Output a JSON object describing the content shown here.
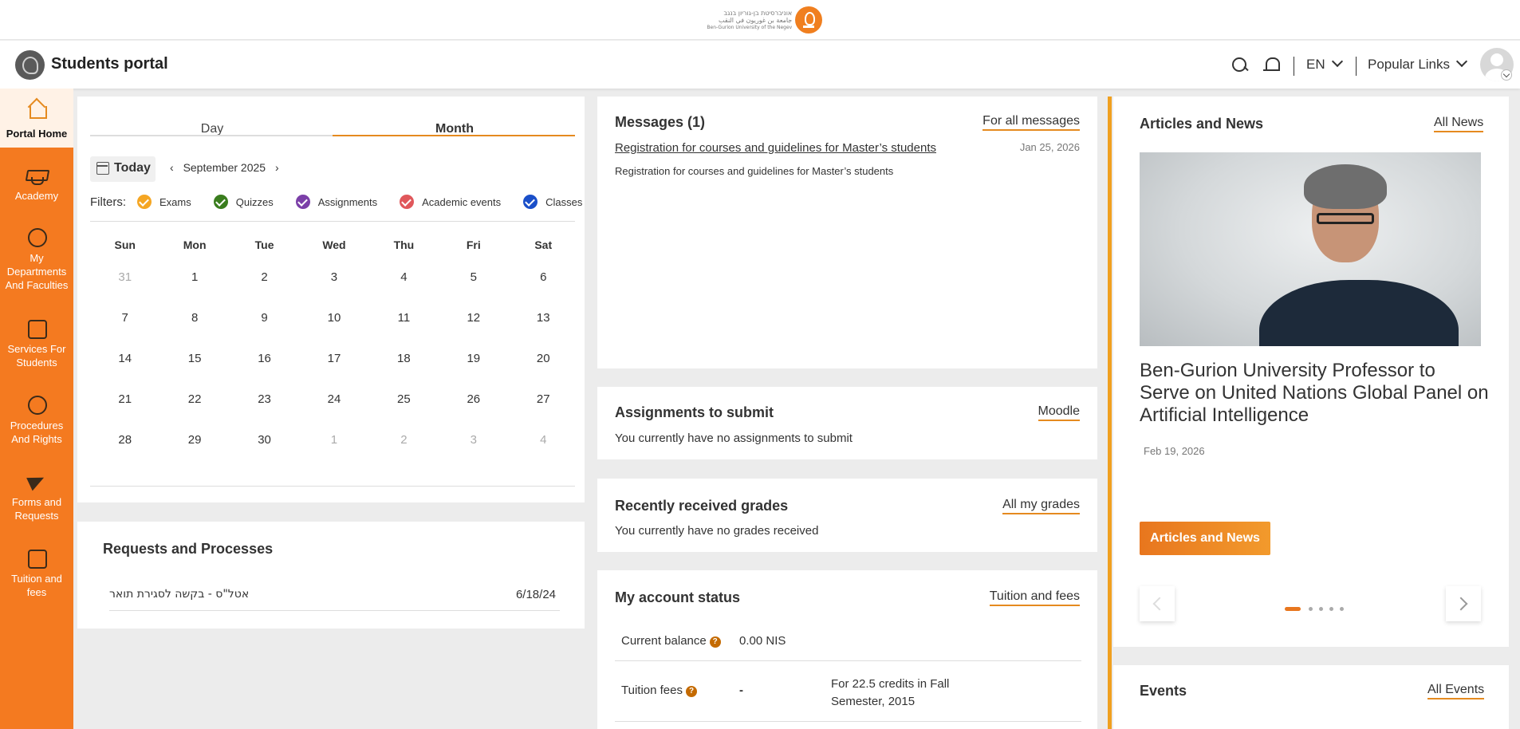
{
  "logo": {
    "hebrew": "אוניברסיטת בן-גוריון בנגב",
    "arabic": "جامعة بن غوريون في النقب",
    "english": "Ben-Gurion University of the Negev"
  },
  "header": {
    "title": "Students portal",
    "language": "EN",
    "popular_links": "Popular Links"
  },
  "sidebar": {
    "items": [
      {
        "label": "Portal Home",
        "icon": "home-icon"
      },
      {
        "label": "Academy",
        "icon": "graduation-cap-icon"
      },
      {
        "label": "My Departments And Faculties",
        "icon": "info-icon"
      },
      {
        "label": "Services For Students",
        "icon": "id-card-icon"
      },
      {
        "label": "Procedures And Rights",
        "icon": "gear-icon"
      },
      {
        "label": "Forms and Requests",
        "icon": "paper-plane-icon"
      },
      {
        "label": "Tuition and fees",
        "icon": "credit-card-icon"
      }
    ]
  },
  "calendar": {
    "tabs": [
      "Day",
      "Month"
    ],
    "today": "Today",
    "month_label": "September 2025",
    "prev": "‹",
    "next": "›",
    "filters_label": "Filters:",
    "filters": [
      {
        "label": "Exams",
        "color": "#f5a623"
      },
      {
        "label": "Quizzes",
        "color": "#3a7d1e"
      },
      {
        "label": "Assignments",
        "color": "#7b3fa8"
      },
      {
        "label": "Academic events",
        "color": "#e0575b"
      },
      {
        "label": "Classes",
        "color": "#1a4fc9"
      }
    ],
    "weekdays": [
      "Sun",
      "Mon",
      "Tue",
      "Wed",
      "Thu",
      "Fri",
      "Sat"
    ],
    "weeks": [
      [
        "31",
        "1",
        "2",
        "3",
        "4",
        "5",
        "6"
      ],
      [
        "7",
        "8",
        "9",
        "10",
        "11",
        "12",
        "13"
      ],
      [
        "14",
        "15",
        "16",
        "17",
        "18",
        "19",
        "20"
      ],
      [
        "21",
        "22",
        "23",
        "24",
        "25",
        "26",
        "27"
      ],
      [
        "28",
        "29",
        "30",
        "1",
        "2",
        "3",
        "4"
      ]
    ]
  },
  "requests": {
    "title": "Requests and Processes",
    "items": [
      {
        "text": "אטל\"ס - בקשה לסגירת תואר",
        "date": "6/18/24"
      }
    ]
  },
  "messages": {
    "title": "Messages (1)",
    "link": "For all messages",
    "subject": "Registration for courses and guidelines for Master’s students",
    "date": "Jan 25, 2026",
    "body": "Registration for courses and guidelines for Master’s students"
  },
  "assignments": {
    "title": "Assignments to submit",
    "link": "Moodle",
    "empty": "You currently have no assignments to submit"
  },
  "grades": {
    "title": "Recently received grades",
    "link": "All my grades",
    "empty": "You currently have no grades received"
  },
  "account": {
    "title": "My account status",
    "link": "Tuition and fees",
    "balance_label": "Current balance",
    "balance_value": "0.00 NIS",
    "tuition_label": "Tuition fees",
    "tuition_value": "-",
    "tuition_note": "For 22.5 credits in Fall Semester, 2015",
    "help_glyph": "?"
  },
  "news": {
    "title": "Articles and News",
    "link": "All News",
    "headline": "Ben-Gurion University Professor to Serve on United Nations Global Panel on Artificial Intelligence",
    "date": "Feb 19, 2026",
    "button": "Articles and News",
    "slide_count": 5,
    "current_slide": 1
  },
  "events": {
    "title": "Events",
    "link": "All Events"
  },
  "colors": {
    "brand_orange": "#f47a20",
    "accent": "#e58a1f"
  }
}
